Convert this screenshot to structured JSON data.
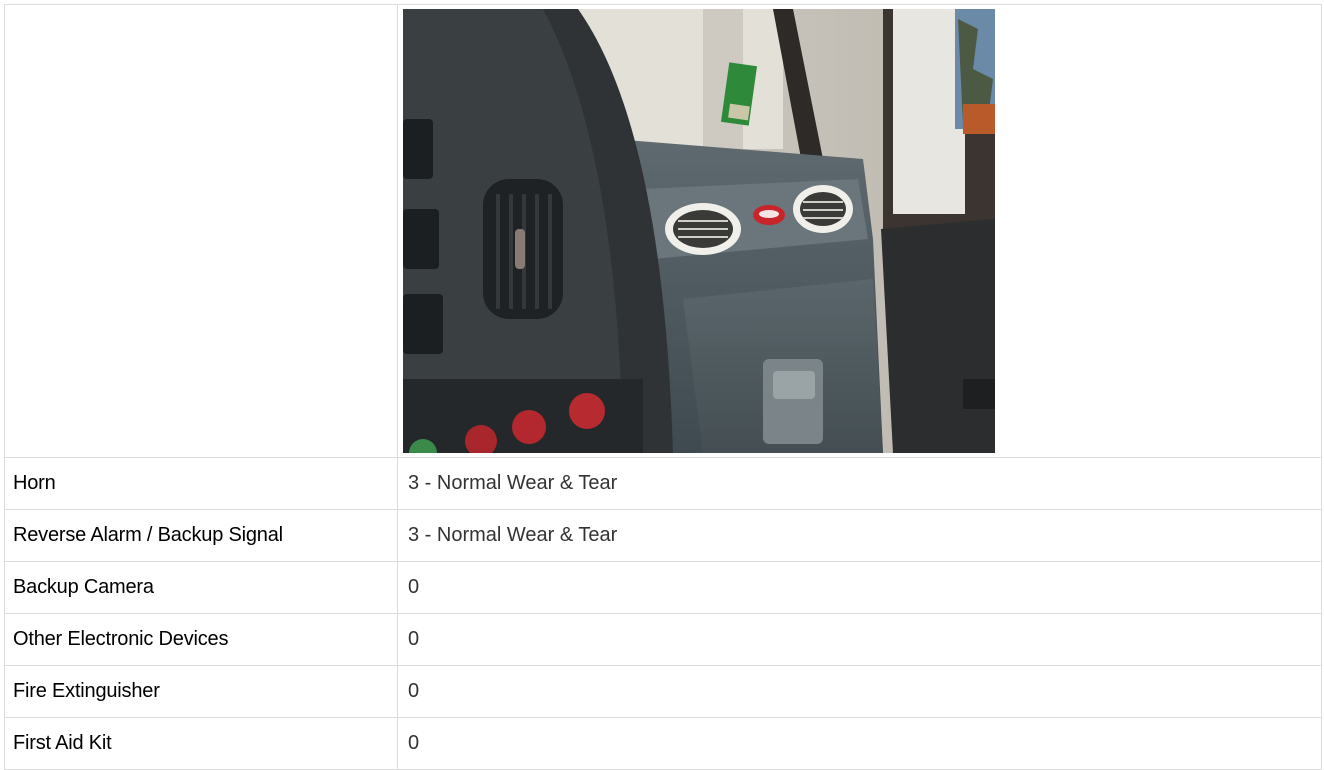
{
  "photo": {
    "alt": "Truck cab dashboard photo",
    "icon": "dashboard-photo"
  },
  "rows": [
    {
      "label": "Horn",
      "value": "3 - Normal Wear & Tear"
    },
    {
      "label": "Reverse Alarm / Backup Signal",
      "value": "3 - Normal Wear & Tear"
    },
    {
      "label": "Backup Camera",
      "value": "0"
    },
    {
      "label": "Other Electronic Devices",
      "value": "0"
    },
    {
      "label": "Fire Extinguisher",
      "value": "0"
    },
    {
      "label": "First Aid Kit",
      "value": "0"
    }
  ]
}
